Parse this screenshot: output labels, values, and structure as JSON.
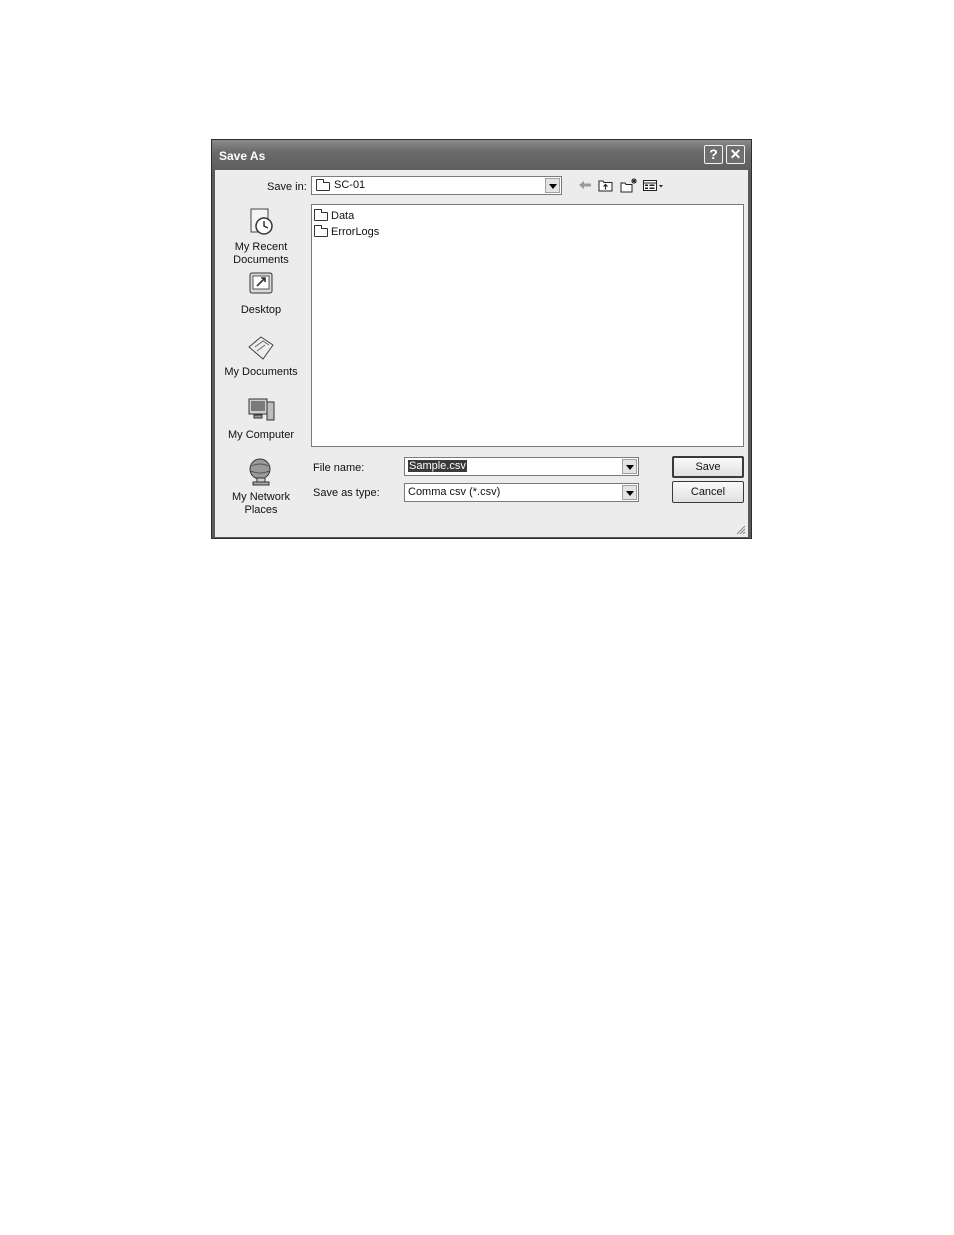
{
  "window": {
    "title": "Save As"
  },
  "titlebar": {
    "help_glyph": "?",
    "close_glyph": "✕"
  },
  "save_in": {
    "label": "Save in:",
    "value": "SC-01"
  },
  "places": [
    {
      "line1": "My Recent",
      "line2": "Documents",
      "icon": "recent-documents-icon"
    },
    {
      "line1": "Desktop",
      "line2": "",
      "icon": "desktop-icon"
    },
    {
      "line1": "My Documents",
      "line2": "",
      "icon": "my-documents-icon"
    },
    {
      "line1": "My Computer",
      "line2": "",
      "icon": "my-computer-icon"
    },
    {
      "line1": "My Network",
      "line2": "Places",
      "icon": "network-places-icon"
    }
  ],
  "files": [
    {
      "name": "Data",
      "icon": "folder-icon"
    },
    {
      "name": "ErrorLogs",
      "icon": "folder-icon"
    }
  ],
  "file_name": {
    "label": "File name:",
    "value": "Sample.csv"
  },
  "save_type": {
    "label": "Save as type:",
    "value": "Comma csv (*.csv)"
  },
  "buttons": {
    "save": "Save",
    "cancel": "Cancel"
  }
}
